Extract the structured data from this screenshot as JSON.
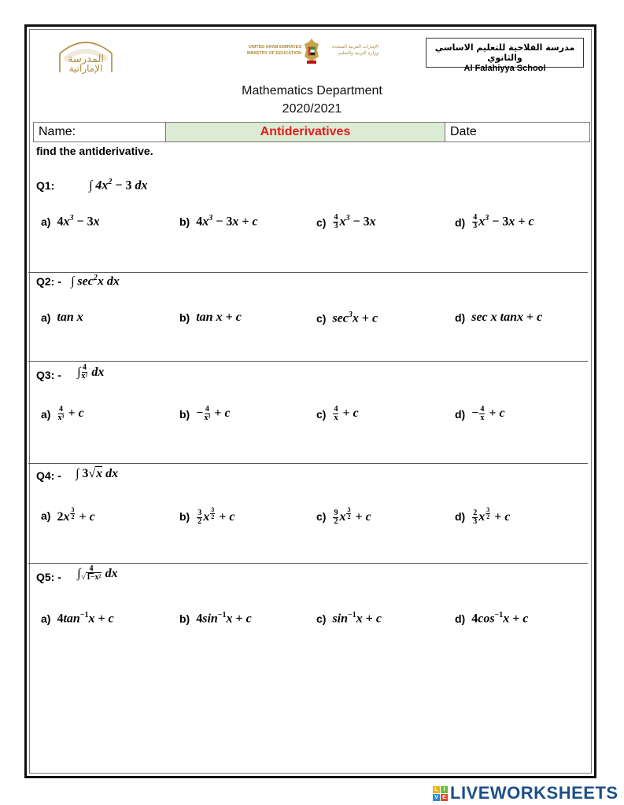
{
  "header": {
    "moe_en_line1": "UNITED ARAB EMIRATES",
    "moe_en_line2": "MINISTRY OF EDUCATION",
    "moe_ar_line1": "الإمارات العربية المتحدة",
    "moe_ar_line2": "وزارة التربية والتعليم",
    "left_logo_ar_line1": "المدرسة",
    "left_logo_ar_line2": "الإماراتية",
    "school_ar": "مدرسة الفلاحية للتعليم الاساسي والثانوي",
    "school_en": "Al Falahiyya School",
    "department": "Mathematics Department",
    "year": "2020/2021"
  },
  "info_row": {
    "name_label": "Name:",
    "title": "Antiderivatives",
    "date_label": "Date"
  },
  "colors": {
    "title_red": "#e21c1c",
    "title_bg": "#dcebd3",
    "logo_gold": "#b08a3a",
    "brand_blue": "#1c4f8a"
  },
  "instruction": "find the antiderivative.",
  "questions": [
    {
      "label": "Q1:",
      "expression": "∫ 4x² − 3 dx",
      "options": [
        {
          "letter": "a)",
          "text": "4x³ − 3x"
        },
        {
          "letter": "b)",
          "text": "4x³ − 3x + c"
        },
        {
          "letter": "c)",
          "text": "(4/3)x³ − 3x"
        },
        {
          "letter": "d)",
          "text": "(4/3)x³ − 3x + c"
        }
      ]
    },
    {
      "label": "Q2: -",
      "expression": "∫ sec²x dx",
      "options": [
        {
          "letter": "a)",
          "text": "tan x"
        },
        {
          "letter": "b)",
          "text": "tan x + c"
        },
        {
          "letter": "c)",
          "text": "sec³x + c"
        },
        {
          "letter": "d)",
          "text": "sec x tanx + c"
        }
      ]
    },
    {
      "label": "Q3: -",
      "expression": "∫ 4/x² dx",
      "options": [
        {
          "letter": "a)",
          "text": "4/x³ + c"
        },
        {
          "letter": "b)",
          "text": "−4/x³ + c"
        },
        {
          "letter": "c)",
          "text": "4/x + c"
        },
        {
          "letter": "d)",
          "text": "−4/x + c"
        }
      ]
    },
    {
      "label": "Q4: -",
      "expression": "∫ 3√x dx",
      "options": [
        {
          "letter": "a)",
          "text": "2x^(3/2) + c"
        },
        {
          "letter": "b)",
          "text": "(3/2)x^(3/2) + c"
        },
        {
          "letter": "c)",
          "text": "(9/2)x^(3/2) + c"
        },
        {
          "letter": "d)",
          "text": "(2/3)x^(3/2) + c"
        }
      ]
    },
    {
      "label": "Q5: -",
      "expression": "∫ 4/√(1−x²) dx",
      "options": [
        {
          "letter": "a)",
          "text": "4tan⁻¹x + c"
        },
        {
          "letter": "b)",
          "text": "4sin⁻¹x + c"
        },
        {
          "letter": "c)",
          "text": "sin⁻¹x + c"
        },
        {
          "letter": "d)",
          "text": "4cos⁻¹x + c"
        }
      ]
    }
  ],
  "parts": {
    "four": "4",
    "three": "3",
    "two": "2",
    "nine": "9",
    "x": "x",
    "one_minus_x2": "1−x²"
  },
  "brand": {
    "text": "LIVEWORKSHEETS",
    "blocks": [
      "L",
      "I",
      "V",
      "E"
    ]
  }
}
